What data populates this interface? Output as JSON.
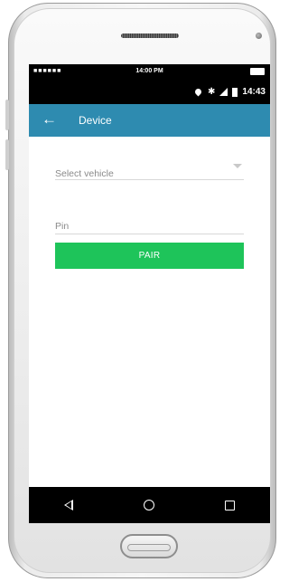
{
  "device": {
    "top_bar_time": "14:00 PM",
    "top_bar_signal": "■■■■■■"
  },
  "status_bar": {
    "time": "14:43",
    "icons": [
      "location-icon",
      "bluetooth-icon",
      "signal-icon",
      "battery-icon"
    ]
  },
  "app_bar": {
    "back_glyph": "←",
    "title": "Device",
    "color": "#2e8bb0"
  },
  "form": {
    "vehicle_select": {
      "placeholder": "Select vehicle",
      "icon": "dropdown-arrow-icon"
    },
    "pin_field": {
      "placeholder": "Pin"
    },
    "pair_button": {
      "label": "PAIR",
      "color": "#1ec45a"
    }
  },
  "nav_bar": {
    "buttons": [
      "back",
      "home",
      "recents"
    ]
  }
}
